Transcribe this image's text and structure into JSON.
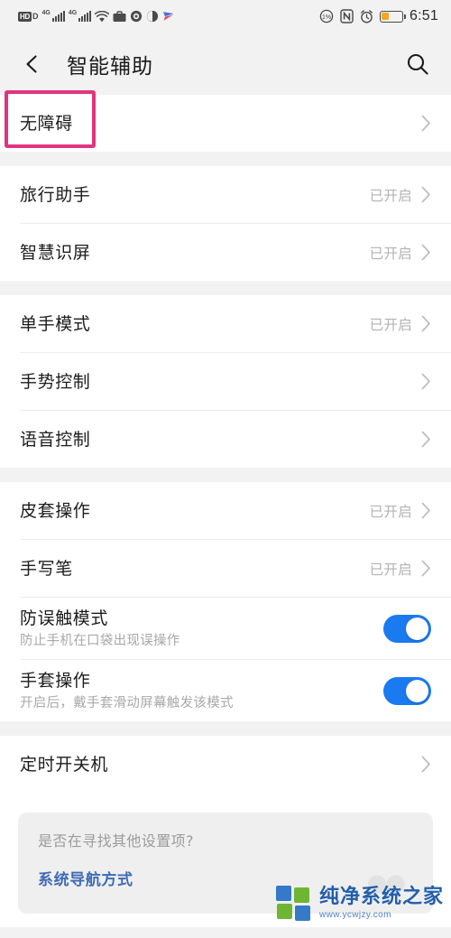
{
  "statusbar": {
    "left_icons": [
      "hd-volte-icon",
      "signal-4g-icon-1",
      "signal-4g-icon-2",
      "wifi-icon",
      "briefcase-icon",
      "vpn-shield-icon",
      "do-not-disturb-icon",
      "app-arrow-icon"
    ],
    "hd_label": "HD",
    "hd_sub": "D",
    "network_label_1": "4G",
    "network_label_2": "4G",
    "right_icons": [
      "data-saver-icon",
      "nfc-icon",
      "alarm-icon",
      "battery-icon"
    ],
    "nfc_label": "N",
    "time": "6:51",
    "battery_percent": 32
  },
  "header": {
    "back_icon": "back-arrow-icon",
    "title": "智能辅助",
    "search_icon": "search-icon"
  },
  "colors": {
    "accent_toggle": "#1a7bf0",
    "highlight_box": "#e0357f",
    "link": "#3f6bb5",
    "value_text": "#b3b3b3",
    "page_bg": "#f2f2f2",
    "card_bg": "#efefef"
  },
  "groups": [
    {
      "items": [
        {
          "title": "无障碍",
          "value": "",
          "type": "chevron",
          "highlighted": true
        }
      ]
    },
    {
      "items": [
        {
          "title": "旅行助手",
          "value": "已开启",
          "type": "chevron"
        },
        {
          "title": "智慧识屏",
          "value": "已开启",
          "type": "chevron"
        }
      ]
    },
    {
      "items": [
        {
          "title": "单手模式",
          "value": "已开启",
          "type": "chevron"
        },
        {
          "title": "手势控制",
          "value": "",
          "type": "chevron"
        },
        {
          "title": "语音控制",
          "value": "",
          "type": "chevron"
        }
      ]
    },
    {
      "items": [
        {
          "title": "皮套操作",
          "value": "已开启",
          "type": "chevron"
        },
        {
          "title": "手写笔",
          "value": "已开启",
          "type": "chevron"
        },
        {
          "title": "防误触模式",
          "subtitle": "防止手机在口袋出现误操作",
          "type": "toggle",
          "checked": true
        },
        {
          "title": "手套操作",
          "subtitle": "开启后，戴手套滑动屏幕触发该模式",
          "type": "toggle",
          "checked": true
        }
      ]
    },
    {
      "items": [
        {
          "title": "定时开关机",
          "value": "",
          "type": "chevron"
        }
      ]
    }
  ],
  "footer": {
    "question": "是否在寻找其他设置项?",
    "link": "系统导航方式"
  },
  "watermark": {
    "name": "纯净系统之家",
    "url": "www.ycwjzy.com"
  }
}
